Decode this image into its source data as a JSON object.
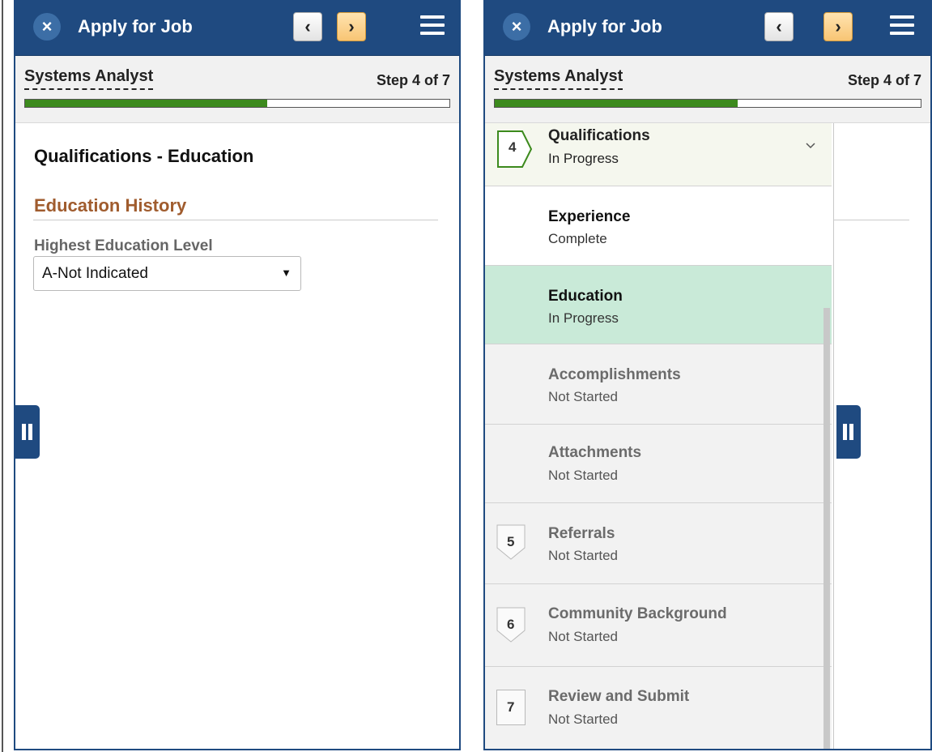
{
  "header": {
    "title": "Apply for Job",
    "close_icon": "×",
    "prev_icon": "‹",
    "next_icon": "›"
  },
  "subheader": {
    "job_title": "Systems Analyst",
    "step_label": "Step 4 of 7",
    "progress": 0.57
  },
  "left": {
    "page_title": "Qualifications - Education",
    "section_title": "Education History",
    "field_label": "Highest Education Level",
    "field_value": "A-Not Indicated"
  },
  "nav": {
    "items": [
      {
        "number": "4",
        "name": "Qualifications",
        "status": "In Progress"
      },
      {
        "name": "Experience",
        "status": "Complete"
      },
      {
        "name": "Education",
        "status": "In Progress"
      },
      {
        "name": "Accomplishments",
        "status": "Not Started"
      },
      {
        "name": "Attachments",
        "status": "Not Started"
      },
      {
        "number": "5",
        "name": "Referrals",
        "status": "Not Started"
      },
      {
        "number": "6",
        "name": "Community Background",
        "status": "Not Started"
      },
      {
        "number": "7",
        "name": "Review and Submit",
        "status": "Not Started"
      }
    ]
  },
  "colors": {
    "header_bg": "#1f4a80",
    "progress_fill": "#3c8a1d",
    "section_title": "#a05c2e",
    "selected_row": "#c9ead8",
    "current_row": "#f5f7ee"
  }
}
